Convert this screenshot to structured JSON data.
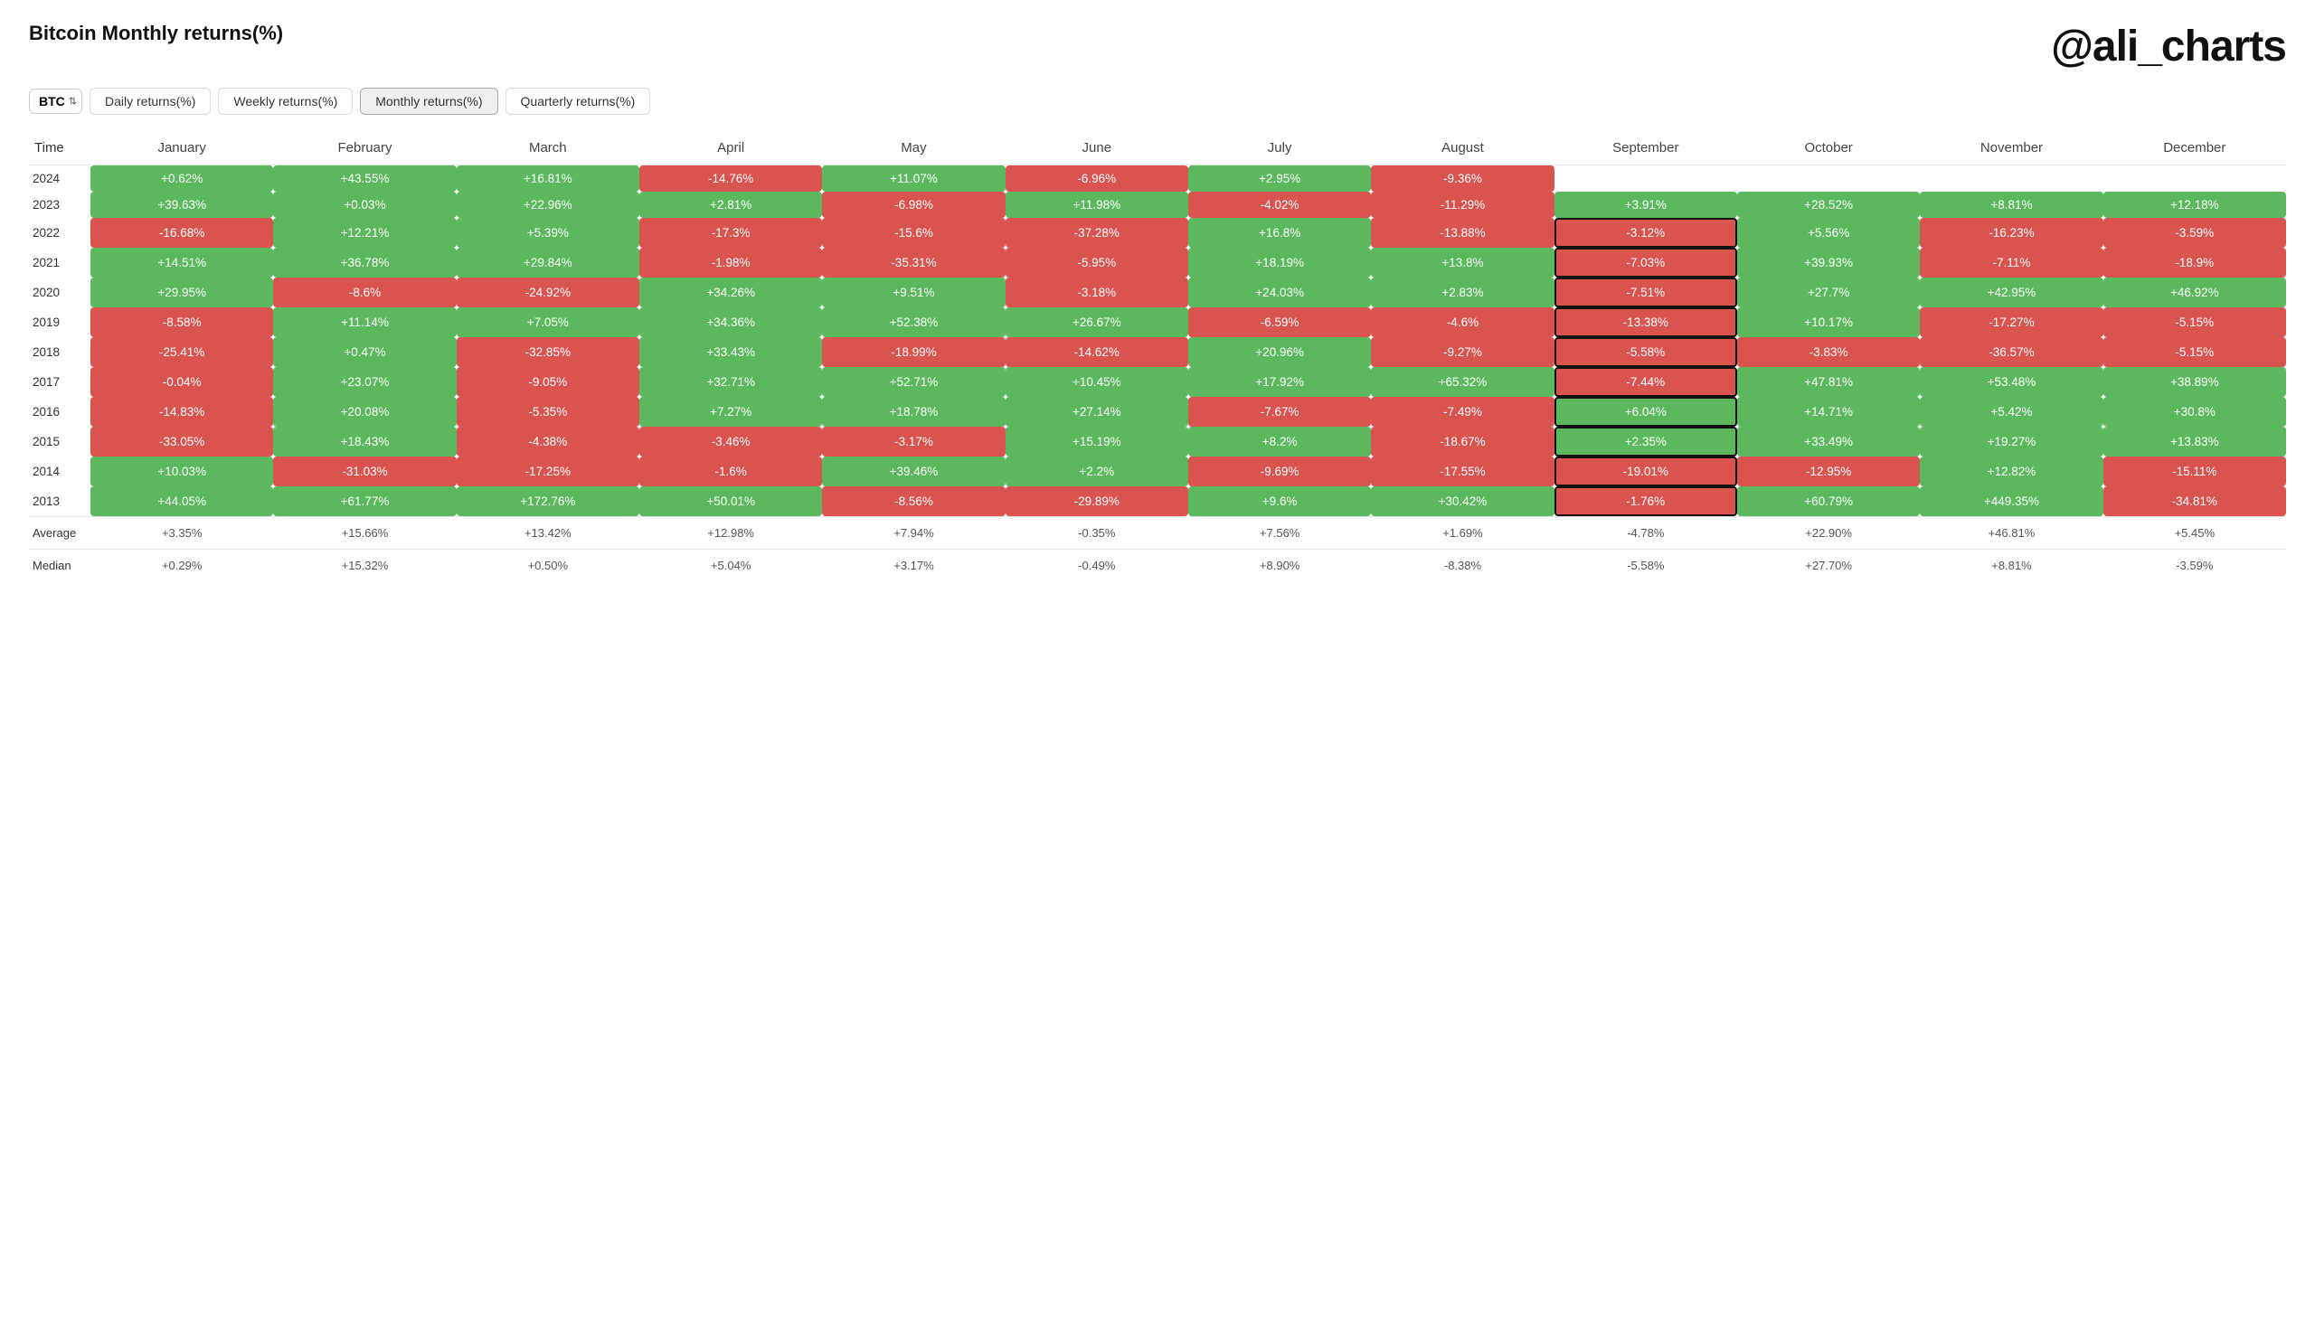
{
  "title": "Bitcoin Monthly returns(%)",
  "brand": "@ali_charts",
  "controls": {
    "asset": "BTC",
    "tabs": [
      {
        "label": "Daily returns(%)",
        "active": false
      },
      {
        "label": "Weekly returns(%)",
        "active": false
      },
      {
        "label": "Monthly returns(%)",
        "active": true
      },
      {
        "label": "Quarterly returns(%)",
        "active": false
      }
    ]
  },
  "columns": [
    "Time",
    "January",
    "February",
    "March",
    "April",
    "May",
    "June",
    "July",
    "August",
    "September",
    "October",
    "November",
    "December"
  ],
  "rows": [
    {
      "year": "2024",
      "values": [
        "+0.62%",
        "+43.55%",
        "+16.81%",
        "-14.76%",
        "+11.07%",
        "-6.96%",
        "+2.95%",
        "-9.36%",
        "",
        "",
        "",
        ""
      ]
    },
    {
      "year": "2023",
      "values": [
        "+39.63%",
        "+0.03%",
        "+22.96%",
        "+2.81%",
        "-6.98%",
        "+11.98%",
        "-4.02%",
        "-11.29%",
        "+3.91%",
        "+28.52%",
        "+8.81%",
        "+12.18%"
      ]
    },
    {
      "year": "2022",
      "values": [
        "-16.68%",
        "+12.21%",
        "+5.39%",
        "-17.3%",
        "-15.6%",
        "-37.28%",
        "+16.8%",
        "-13.88%",
        "-3.12%",
        "+5.56%",
        "-16.23%",
        "-3.59%"
      ]
    },
    {
      "year": "2021",
      "values": [
        "+14.51%",
        "+36.78%",
        "+29.84%",
        "-1.98%",
        "-35.31%",
        "-5.95%",
        "+18.19%",
        "+13.8%",
        "-7.03%",
        "+39.93%",
        "-7.11%",
        "-18.9%"
      ]
    },
    {
      "year": "2020",
      "values": [
        "+29.95%",
        "-8.6%",
        "-24.92%",
        "+34.26%",
        "+9.51%",
        "-3.18%",
        "+24.03%",
        "+2.83%",
        "-7.51%",
        "+27.7%",
        "+42.95%",
        "+46.92%"
      ]
    },
    {
      "year": "2019",
      "values": [
        "-8.58%",
        "+11.14%",
        "+7.05%",
        "+34.36%",
        "+52.38%",
        "+26.67%",
        "-6.59%",
        "-4.6%",
        "-13.38%",
        "+10.17%",
        "-17.27%",
        "-5.15%"
      ]
    },
    {
      "year": "2018",
      "values": [
        "-25.41%",
        "+0.47%",
        "-32.85%",
        "+33.43%",
        "-18.99%",
        "-14.62%",
        "+20.96%",
        "-9.27%",
        "-5.58%",
        "-3.83%",
        "-36.57%",
        "-5.15%"
      ]
    },
    {
      "year": "2017",
      "values": [
        "-0.04%",
        "+23.07%",
        "-9.05%",
        "+32.71%",
        "+52.71%",
        "+10.45%",
        "+17.92%",
        "+65.32%",
        "-7.44%",
        "+47.81%",
        "+53.48%",
        "+38.89%"
      ]
    },
    {
      "year": "2016",
      "values": [
        "-14.83%",
        "+20.08%",
        "-5.35%",
        "+7.27%",
        "+18.78%",
        "+27.14%",
        "-7.67%",
        "-7.49%",
        "+6.04%",
        "+14.71%",
        "+5.42%",
        "+30.8%"
      ]
    },
    {
      "year": "2015",
      "values": [
        "-33.05%",
        "+18.43%",
        "-4.38%",
        "-3.46%",
        "-3.17%",
        "+15.19%",
        "+8.2%",
        "-18.67%",
        "+2.35%",
        "+33.49%",
        "+19.27%",
        "+13.83%"
      ]
    },
    {
      "year": "2014",
      "values": [
        "+10.03%",
        "-31.03%",
        "-17.25%",
        "-1.6%",
        "+39.46%",
        "+2.2%",
        "-9.69%",
        "-17.55%",
        "-19.01%",
        "-12.95%",
        "+12.82%",
        "-15.11%"
      ]
    },
    {
      "year": "2013",
      "values": [
        "+44.05%",
        "+61.77%",
        "+172.76%",
        "+50.01%",
        "-8.56%",
        "-29.89%",
        "+9.6%",
        "+30.42%",
        "-1.76%",
        "+60.79%",
        "+449.35%",
        "-34.81%"
      ]
    }
  ],
  "summary": [
    {
      "label": "Average",
      "values": [
        "+3.35%",
        "+15.66%",
        "+13.42%",
        "+12.98%",
        "+7.94%",
        "-0.35%",
        "+7.56%",
        "+1.69%",
        "-4.78%",
        "+22.90%",
        "+46.81%",
        "+5.45%"
      ]
    },
    {
      "label": "Median",
      "values": [
        "+0.29%",
        "+15.32%",
        "+0.50%",
        "+5.04%",
        "+3.17%",
        "-0.49%",
        "+8.90%",
        "-8.38%",
        "-5.58%",
        "+27.70%",
        "+8.81%",
        "-3.59%"
      ]
    }
  ]
}
